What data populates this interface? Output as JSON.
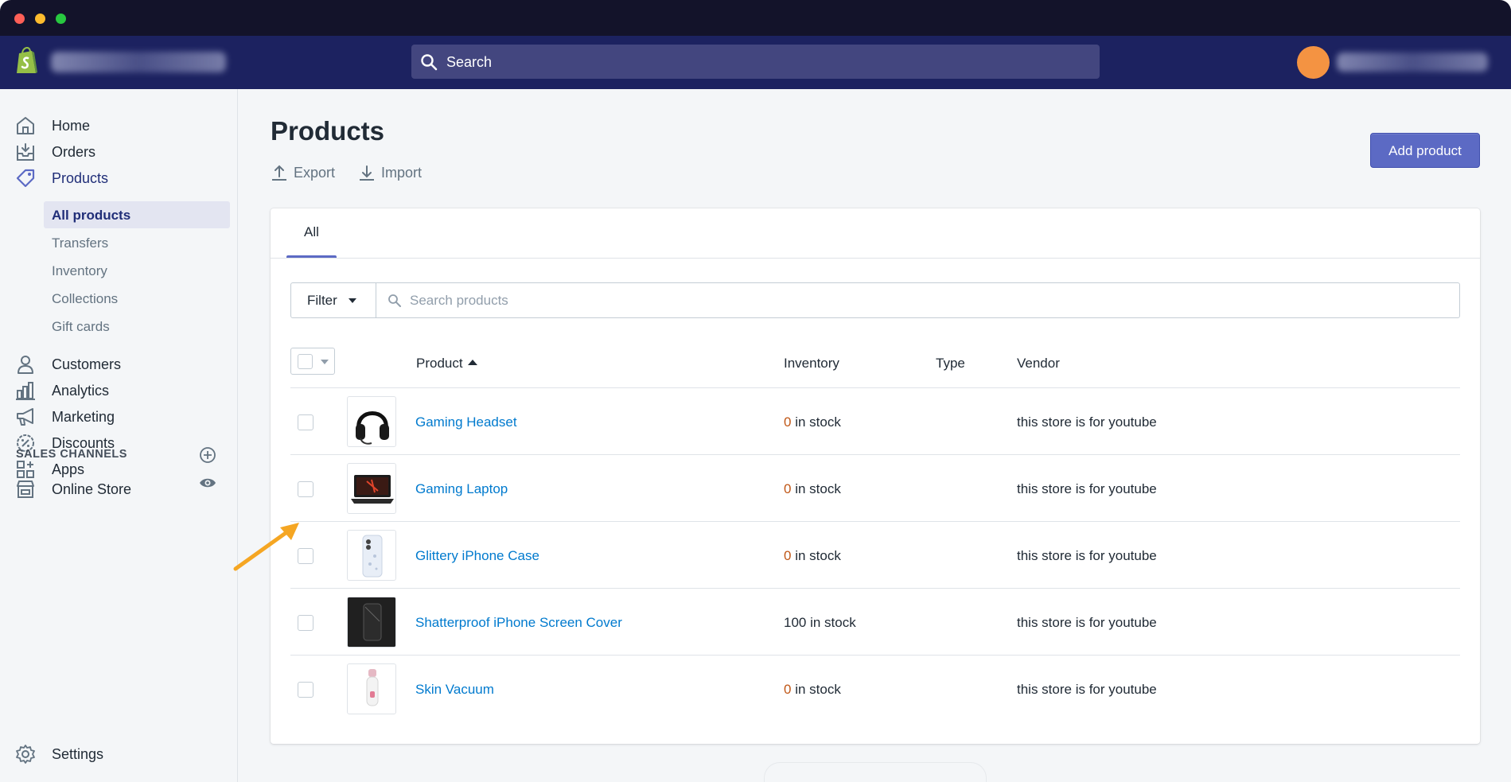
{
  "header": {
    "search_placeholder": "Search"
  },
  "sidebar": {
    "items": [
      {
        "label": "Home"
      },
      {
        "label": "Orders"
      },
      {
        "label": "Products"
      },
      {
        "label": "Customers"
      },
      {
        "label": "Analytics"
      },
      {
        "label": "Marketing"
      },
      {
        "label": "Discounts"
      },
      {
        "label": "Apps"
      }
    ],
    "product_subitems": [
      {
        "label": "All products"
      },
      {
        "label": "Transfers"
      },
      {
        "label": "Inventory"
      },
      {
        "label": "Collections"
      },
      {
        "label": "Gift cards"
      }
    ],
    "sales_channels_title": "SALES CHANNELS",
    "online_store": "Online Store",
    "settings": "Settings"
  },
  "main": {
    "title": "Products",
    "export_label": "Export",
    "import_label": "Import",
    "add_product_label": "Add product",
    "tabs": [
      {
        "label": "All"
      }
    ],
    "filter_label": "Filter",
    "search_products_placeholder": "Search products",
    "columns": {
      "product": "Product",
      "inventory": "Inventory",
      "type": "Type",
      "vendor": "Vendor"
    },
    "rows": [
      {
        "name": "Gaming Headset",
        "qty": "0",
        "stock_suffix": " in stock",
        "type": "",
        "vendor": "this store is for youtube",
        "thumb_icon": "headset-thumbnail"
      },
      {
        "name": "Gaming Laptop",
        "qty": "0",
        "stock_suffix": " in stock",
        "type": "",
        "vendor": "this store is for youtube",
        "thumb_icon": "laptop-thumbnail"
      },
      {
        "name": "Glittery iPhone Case",
        "qty": "0",
        "stock_suffix": " in stock",
        "type": "",
        "vendor": "this store is for youtube",
        "thumb_icon": "phone-case-thumbnail"
      },
      {
        "name": "Shatterproof iPhone Screen Cover",
        "qty": "100",
        "stock_suffix": " in stock",
        "type": "",
        "vendor": "this store is for youtube",
        "thumb_icon": "screen-cover-thumbnail"
      },
      {
        "name": "Skin Vacuum",
        "qty": "0",
        "stock_suffix": " in stock",
        "type": "",
        "vendor": "this store is for youtube",
        "thumb_icon": "skin-vacuum-thumbnail"
      }
    ]
  },
  "colors": {
    "topbar": "#1c2260",
    "primary_button": "#5c6ac4",
    "link": "#007ace",
    "zero_stock": "#c05717",
    "avatar": "#f49342",
    "annotation_arrow": "#f5a623"
  }
}
